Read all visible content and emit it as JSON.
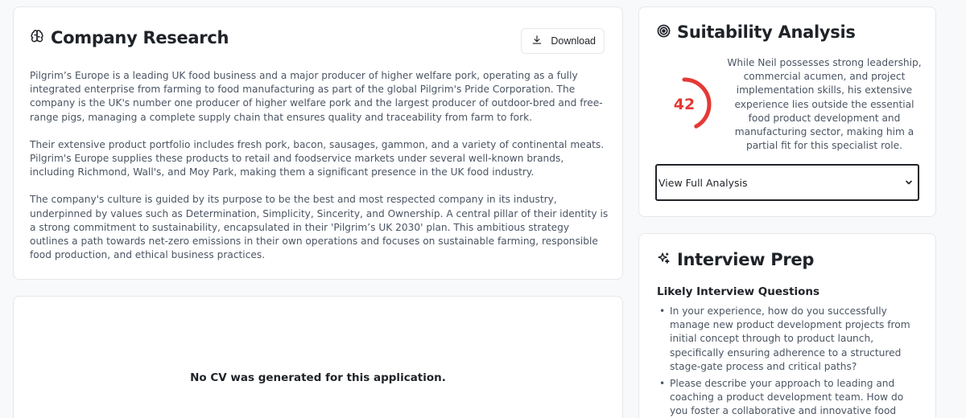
{
  "research": {
    "title": "Company Research",
    "download_label": "Download",
    "paragraphs": [
      "Pilgrim’s Europe is a leading UK food business and a major producer of higher welfare pork, operating as a fully integrated enterprise from farming to food manufacturing as part of the global Pilgrim's Pride Corporation. The company is the UK's number one producer of higher welfare pork and the largest producer of outdoor-bred and free-range pigs, managing a complete supply chain that ensures quality and traceability from farm to fork.",
      "Their extensive product portfolio includes fresh pork, bacon, sausages, gammon, and a variety of continental meats. Pilgrim's Europe supplies these products to retail and foodservice markets under several well-known brands, including Richmond, Wall's, and Moy Park, making them a significant presence in the UK food industry.",
      "The company's culture is guided by its purpose to be the best and most respected company in its industry, underpinned by values such as Determination, Simplicity, Sincerity, and Ownership. A central pillar of their identity is a strong commitment to sustainability, encapsulated in their 'Pilgrim’s UK 2030' plan. This ambitious strategy outlines a path towards net-zero emissions in their own operations and focuses on sustainable farming, responsible food production, and ethical business practices."
    ]
  },
  "cv": {
    "message": "No CV was generated for this application."
  },
  "suitability": {
    "title": "Suitability Analysis",
    "score": "42",
    "score_fraction": 0.42,
    "score_color": "#e53935",
    "summary": "While Neil possesses strong leadership, commercial acumen, and project implementation skills, his extensive experience lies outside the essential food product development and manufacturing sector, making him a partial fit for this specialist role.",
    "select_label": "View Full Analysis"
  },
  "interview": {
    "title": "Interview Prep",
    "subtitle": "Likely Interview Questions",
    "questions": [
      "In your experience, how do you successfully manage new product development projects from initial concept through to product launch, specifically ensuring adherence to a structured stage-gate process and critical paths?",
      "Please describe your approach to leading and coaching a product development team. How do you foster a collaborative and innovative food"
    ]
  },
  "icons": {
    "research": "brain-icon",
    "download": "download-icon",
    "suitability": "target-icon",
    "chevron": "chevron-down-icon",
    "interview": "sparkles-icon"
  }
}
